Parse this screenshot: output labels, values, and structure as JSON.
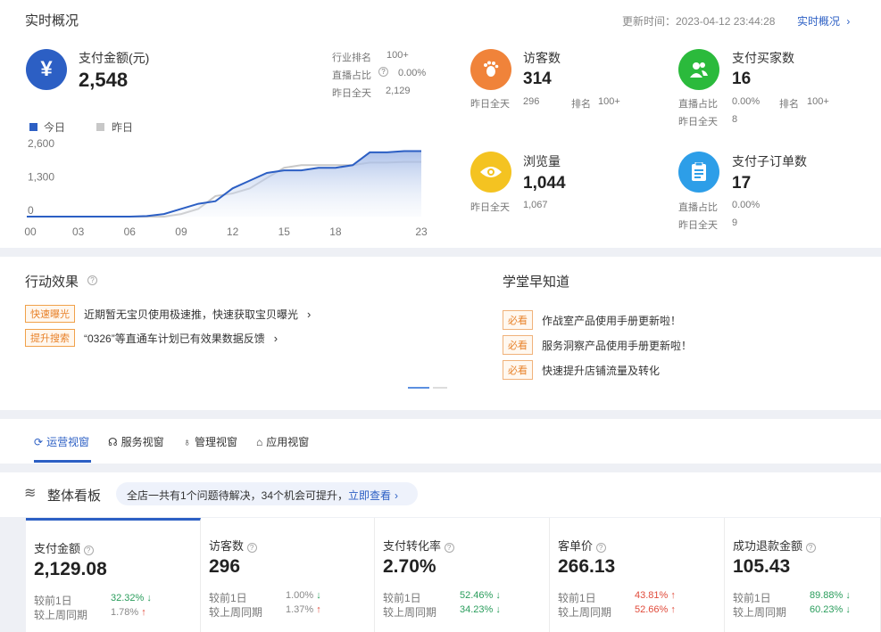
{
  "overview": {
    "title": "实时概况",
    "update_label": "更新时间：2023-04-12 23:44:28",
    "link": "实时概况"
  },
  "payment": {
    "label": "支付金额(元)",
    "value": "2,548",
    "rank_label": "行业排名",
    "rank_value": "100+",
    "live_label": "直播占比",
    "live_value": "0.00%",
    "yesterday_label": "昨日全天",
    "yesterday_value": "2,129"
  },
  "chart_data": {
    "type": "line",
    "legend": [
      "今日",
      "昨日"
    ],
    "x_ticks": [
      "00",
      "03",
      "06",
      "09",
      "12",
      "15",
      "18",
      "23"
    ],
    "y_ticks": [
      "2,600",
      "1,300",
      "0"
    ],
    "ylim": [
      0,
      2600
    ],
    "xlim": [
      0,
      23
    ],
    "series": [
      {
        "name": "今日",
        "color": "#2c5fc4",
        "x": [
          0,
          6,
          7,
          8,
          9,
          10,
          11,
          12,
          13,
          14,
          15,
          16,
          17,
          18,
          19,
          20,
          21,
          22,
          23
        ],
        "y": [
          0,
          0,
          20,
          100,
          300,
          500,
          600,
          1100,
          1400,
          1700,
          1800,
          1800,
          1900,
          1900,
          2000,
          2500,
          2500,
          2548,
          2548
        ]
      },
      {
        "name": "昨日",
        "color": "#c8c8c8",
        "x": [
          0,
          8,
          9,
          10,
          11,
          12,
          13,
          14,
          15,
          16,
          17,
          18,
          19,
          20,
          21,
          22,
          23
        ],
        "y": [
          0,
          0,
          100,
          300,
          800,
          900,
          1100,
          1500,
          1900,
          2000,
          2000,
          2000,
          2000,
          2100,
          2100,
          2129,
          2129
        ]
      }
    ]
  },
  "metrics": [
    {
      "label": "访客数",
      "value": "314",
      "icon": "footprint-icon",
      "color": "#f0833a",
      "yesterday_label": "昨日全天",
      "yesterday_value": "296",
      "rank_label": "排名",
      "rank_value": "100+"
    },
    {
      "label": "支付买家数",
      "value": "16",
      "icon": "buyers-icon",
      "color": "#2bba3c",
      "live_label": "直播占比",
      "live_value": "0.00%",
      "rank_label": "排名",
      "rank_value": "100+",
      "yesterday_label": "昨日全天",
      "yesterday_value": "8"
    },
    {
      "label": "浏览量",
      "value": "1,044",
      "icon": "eye-icon",
      "color": "#f4c321",
      "yesterday_label": "昨日全天",
      "yesterday_value": "1,067"
    },
    {
      "label": "支付子订单数",
      "value": "17",
      "icon": "order-icon",
      "color": "#2d9ee8",
      "live_label": "直播占比",
      "live_value": "0.00%",
      "yesterday_label": "昨日全天",
      "yesterday_value": "9"
    }
  ],
  "action": {
    "title": "行动效果",
    "items": [
      {
        "tag": "快速曝光",
        "text": "近期暂无宝贝使用极速推，快速获取宝贝曝光"
      },
      {
        "tag": "提升搜索",
        "text": "“0326”等直通车计划已有效果数据反馈"
      }
    ]
  },
  "learn": {
    "title": "学堂早知道",
    "items": [
      {
        "tag": "必看",
        "text": "作战室产品使用手册更新啦！"
      },
      {
        "tag": "必看",
        "text": "服务洞察产品使用手册更新啦！"
      },
      {
        "tag": "必看",
        "text": "快速提升店铺流量及转化"
      }
    ]
  },
  "tabs": [
    {
      "label": "运营视窗",
      "active": true
    },
    {
      "label": "服务视窗",
      "active": false
    },
    {
      "label": "管理视窗",
      "active": false
    },
    {
      "label": "应用视窗",
      "active": false
    }
  ],
  "board": {
    "title": "整体看板",
    "notice": "全店一共有1个问题待解决，34个机会可提升，",
    "notice_link": "立即查看"
  },
  "cards": [
    {
      "label": "支付金额",
      "value": "2,129.08",
      "r1_label": "较前1日",
      "r1_value": "32.32%",
      "r1_dir": "down",
      "r2_label": "较上周同期",
      "r2_value": "1.78%",
      "r2_dir": "up"
    },
    {
      "label": "访客数",
      "value": "296",
      "r1_label": "较前1日",
      "r1_value": "1.00%",
      "r1_dir": "down",
      "r2_label": "较上周同期",
      "r2_value": "1.37%",
      "r2_dir": "up"
    },
    {
      "label": "支付转化率",
      "value": "2.70%",
      "r1_label": "较前1日",
      "r1_value": "52.46%",
      "r1_dir": "down",
      "r2_label": "较上周同期",
      "r2_value": "34.23%",
      "r2_dir": "down"
    },
    {
      "label": "客单价",
      "value": "266.13",
      "r1_label": "较前1日",
      "r1_value": "43.81%",
      "r1_dir": "up",
      "r2_label": "较上周同期",
      "r2_value": "52.66%",
      "r2_dir": "up"
    },
    {
      "label": "成功退款金额",
      "value": "105.43",
      "r1_label": "较前1日",
      "r1_value": "89.88%",
      "r1_dir": "down",
      "r2_label": "较上周同期",
      "r2_value": "60.23%",
      "r2_dir": "down"
    }
  ]
}
